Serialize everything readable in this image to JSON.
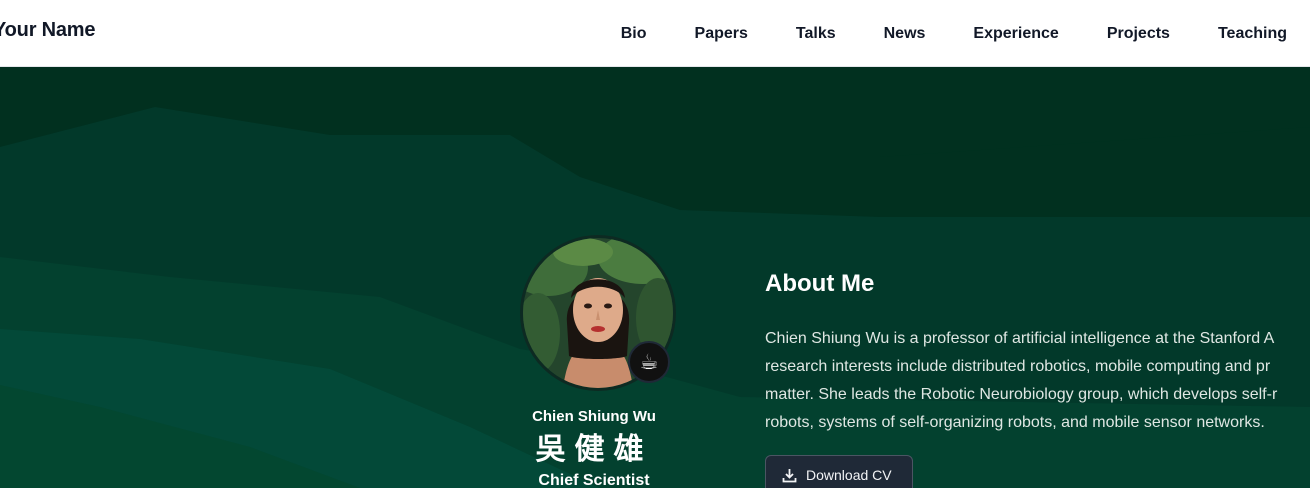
{
  "header": {
    "brand": "Your Name",
    "nav": [
      {
        "label": "Bio"
      },
      {
        "label": "Papers"
      },
      {
        "label": "Talks"
      },
      {
        "label": "News"
      },
      {
        "label": "Experience"
      },
      {
        "label": "Projects"
      },
      {
        "label": "Teaching"
      }
    ]
  },
  "profile": {
    "name": "Chien Shiung Wu",
    "name_cjk": "吳健雄",
    "role": "Chief Scientist",
    "status_emoji": "☕",
    "avatar_icon": "avatar-photo"
  },
  "about": {
    "title": "About Me",
    "lines": [
      "Chien Shiung Wu is a professor of artificial intelligence at the Stanford A",
      "research interests include distributed robotics, mobile computing and pr",
      "matter. She leads the Robotic Neurobiology group, which develops self-r",
      "robots, systems of self-organizing robots, and mobile sensor networks."
    ],
    "download_label": "Download CV",
    "download_icon": "download-icon"
  },
  "colors": {
    "hero_dark": "#01301f",
    "hero_mid": "#02392a",
    "hero_light": "#045040",
    "button_bg": "#1f2937"
  }
}
